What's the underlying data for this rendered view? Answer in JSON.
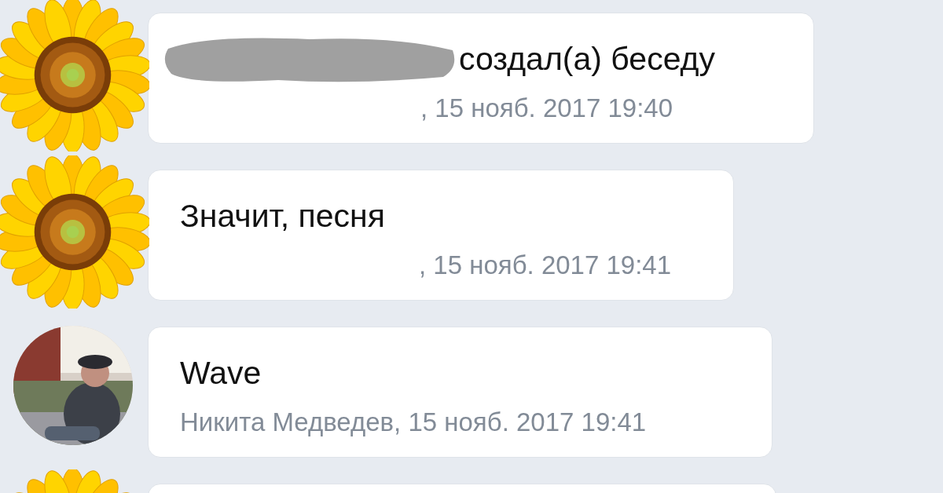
{
  "messages": [
    {
      "avatar": {
        "kind": "sunflower"
      },
      "redacted": true,
      "text": "создал(а) беседу",
      "meta": ", 15 нояб. 2017 19:40"
    },
    {
      "avatar": {
        "kind": "sunflower"
      },
      "redacted": false,
      "text": "Значит, песня",
      "meta": ", 15 нояб. 2017 19:41"
    },
    {
      "redacted": false,
      "text": "Wave",
      "meta": "Никита Медведев, 15 нояб. 2017 19:41"
    },
    {
      "avatar": {
        "kind": "sunflower"
      }
    }
  ]
}
